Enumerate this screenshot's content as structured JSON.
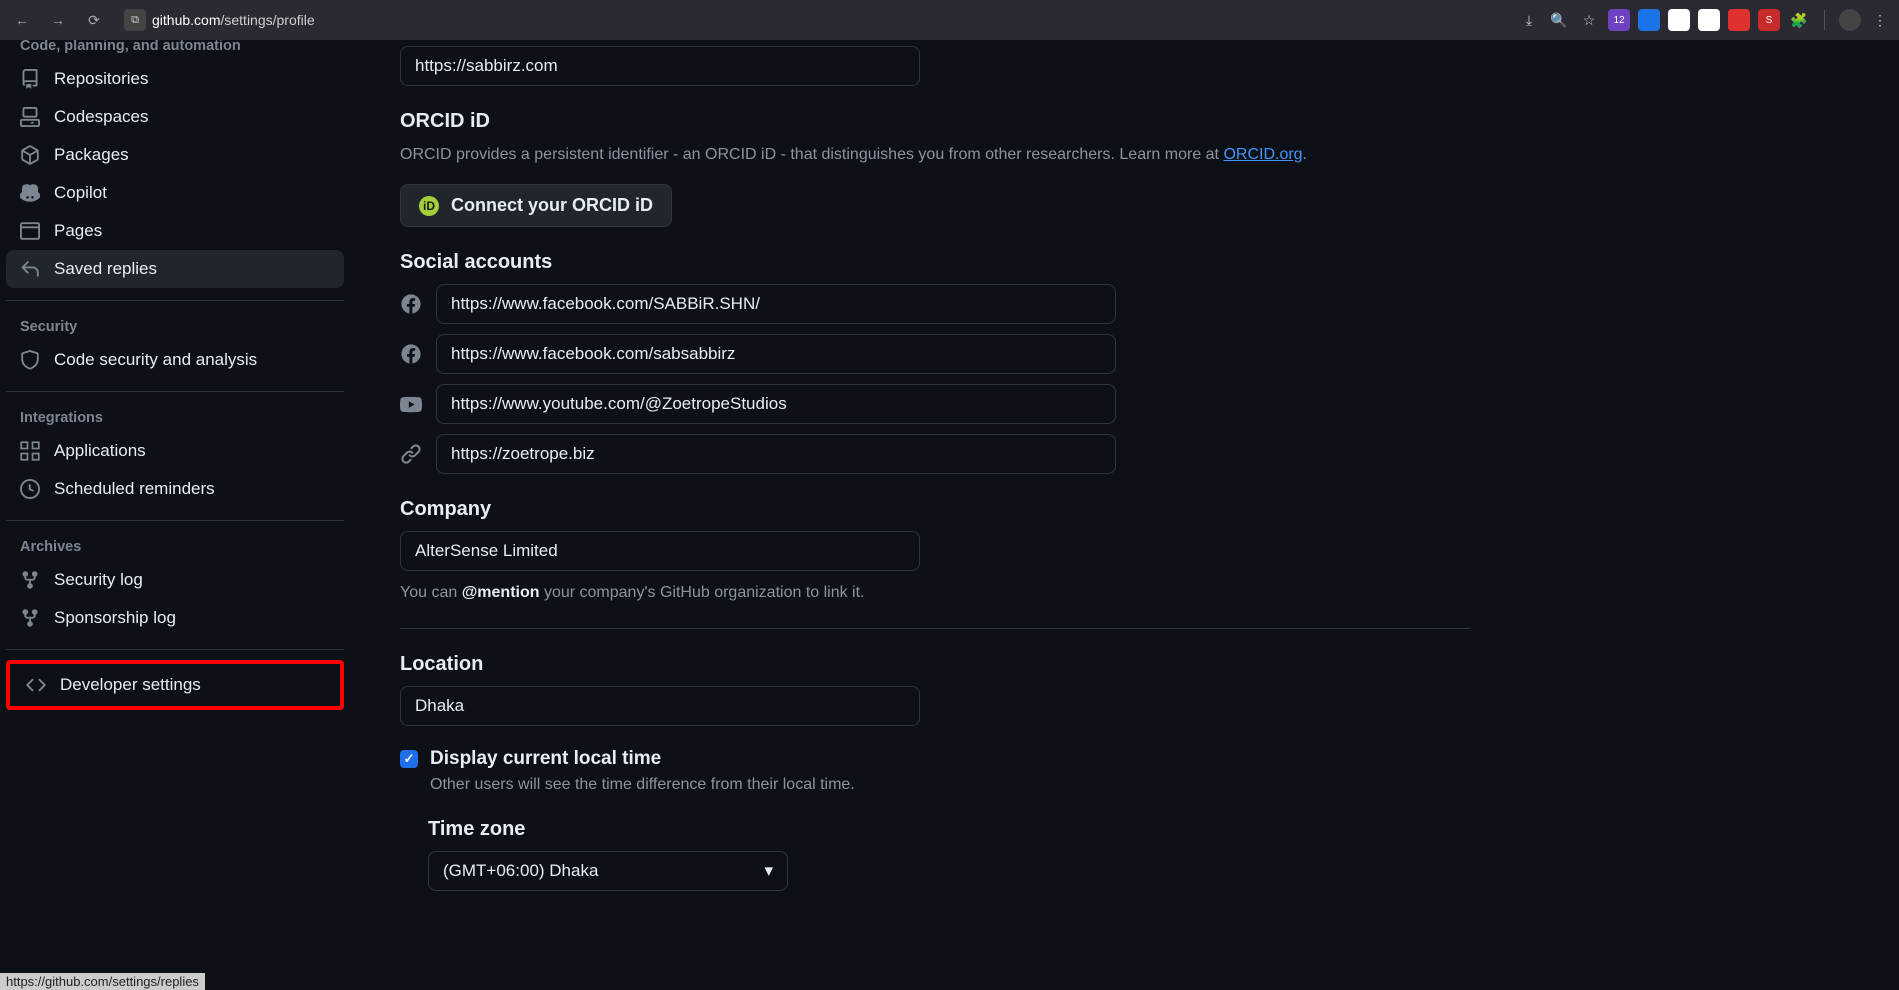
{
  "browser": {
    "url_host": "github.com",
    "url_path": "/settings/profile",
    "status_url": "https://github.com/settings/replies"
  },
  "sidebar": {
    "section_code": "Code, planning, and automation",
    "items_code": [
      {
        "label": "Repositories"
      },
      {
        "label": "Codespaces"
      },
      {
        "label": "Packages"
      },
      {
        "label": "Copilot"
      },
      {
        "label": "Pages"
      },
      {
        "label": "Saved replies"
      }
    ],
    "section_security": "Security",
    "items_security": [
      {
        "label": "Code security and analysis"
      }
    ],
    "section_integrations": "Integrations",
    "items_integrations": [
      {
        "label": "Applications"
      },
      {
        "label": "Scheduled reminders"
      }
    ],
    "section_archives": "Archives",
    "items_archives": [
      {
        "label": "Security log"
      },
      {
        "label": "Sponsorship log"
      }
    ],
    "developer_settings": "Developer settings"
  },
  "form": {
    "website_value": "https://sabbirz.com",
    "orcid_heading": "ORCID iD",
    "orcid_help_1": "ORCID provides a persistent identifier - an ORCID iD - that distinguishes you from other researchers. Learn more at ",
    "orcid_link": "ORCID.org",
    "orcid_help_2": ".",
    "orcid_button": "Connect your ORCID iD",
    "social_heading": "Social accounts",
    "social": [
      {
        "value": "https://www.facebook.com/SABBiR.SHN/"
      },
      {
        "value": "https://www.facebook.com/sabsabbirz"
      },
      {
        "value": "https://www.youtube.com/@ZoetropeStudios"
      },
      {
        "value": "https://zoetrope.biz"
      }
    ],
    "company_heading": "Company",
    "company_value": "AlterSense Limited",
    "company_help_1": "You can ",
    "company_help_mention": "@mention",
    "company_help_2": " your company's GitHub organization to link it.",
    "location_heading": "Location",
    "location_value": "Dhaka",
    "localtime_checkbox": "Display current local time",
    "localtime_help": "Other users will see the time difference from their local time.",
    "timezone_heading": "Time zone",
    "timezone_value": "(GMT+06:00) Dhaka"
  }
}
